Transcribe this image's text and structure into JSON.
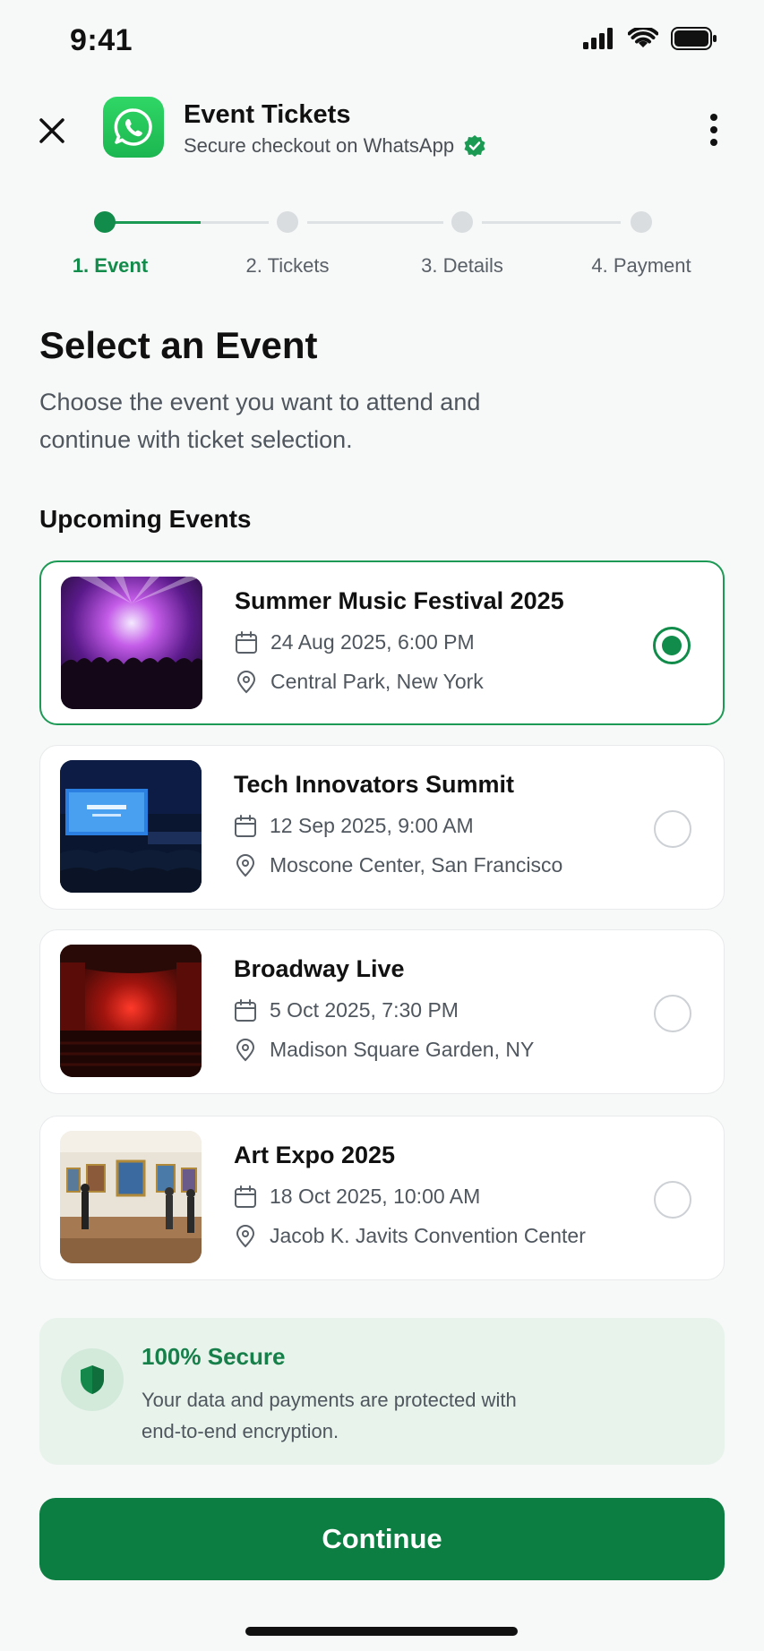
{
  "status_bar": {
    "time": "9:41"
  },
  "header": {
    "title": "Event Tickets",
    "subtitle": "Secure checkout on WhatsApp"
  },
  "stepper": {
    "steps": [
      {
        "label": "1. Event",
        "active": true
      },
      {
        "label": "2. Tickets",
        "active": false
      },
      {
        "label": "3. Details",
        "active": false
      },
      {
        "label": "4. Payment",
        "active": false
      }
    ]
  },
  "page": {
    "title": "Select an Event",
    "description": "Choose the event you want to attend and continue with ticket selection.",
    "section_title": "Upcoming Events"
  },
  "events": [
    {
      "name": "Summer Music Festival 2025",
      "date": "24 Aug 2025, 6:00 PM",
      "location": "Central Park, New York",
      "selected": true,
      "image": "concert-photo"
    },
    {
      "name": "Tech Innovators Summit",
      "date": "12 Sep 2025, 9:00 AM",
      "location": "Moscone Center, San Francisco",
      "selected": false,
      "image": "conference-photo"
    },
    {
      "name": "Broadway Live",
      "date": "5 Oct 2025, 7:30 PM",
      "location": "Madison Square Garden, NY",
      "selected": false,
      "image": "theater-photo"
    },
    {
      "name": "Art Expo 2025",
      "date": "18 Oct 2025, 10:00 AM",
      "location": "Jacob K. Javits Convention Center",
      "selected": false,
      "image": "gallery-photo"
    }
  ],
  "secure_banner": {
    "title": "100% Secure",
    "text": "Your data and payments are protected with end-to-end encryption."
  },
  "continue_label": "Continue",
  "colors": {
    "accent": "#128c4a",
    "button": "#0c7e42",
    "secure_bg": "#e8f3ec",
    "whatsapp": "#25d366"
  }
}
